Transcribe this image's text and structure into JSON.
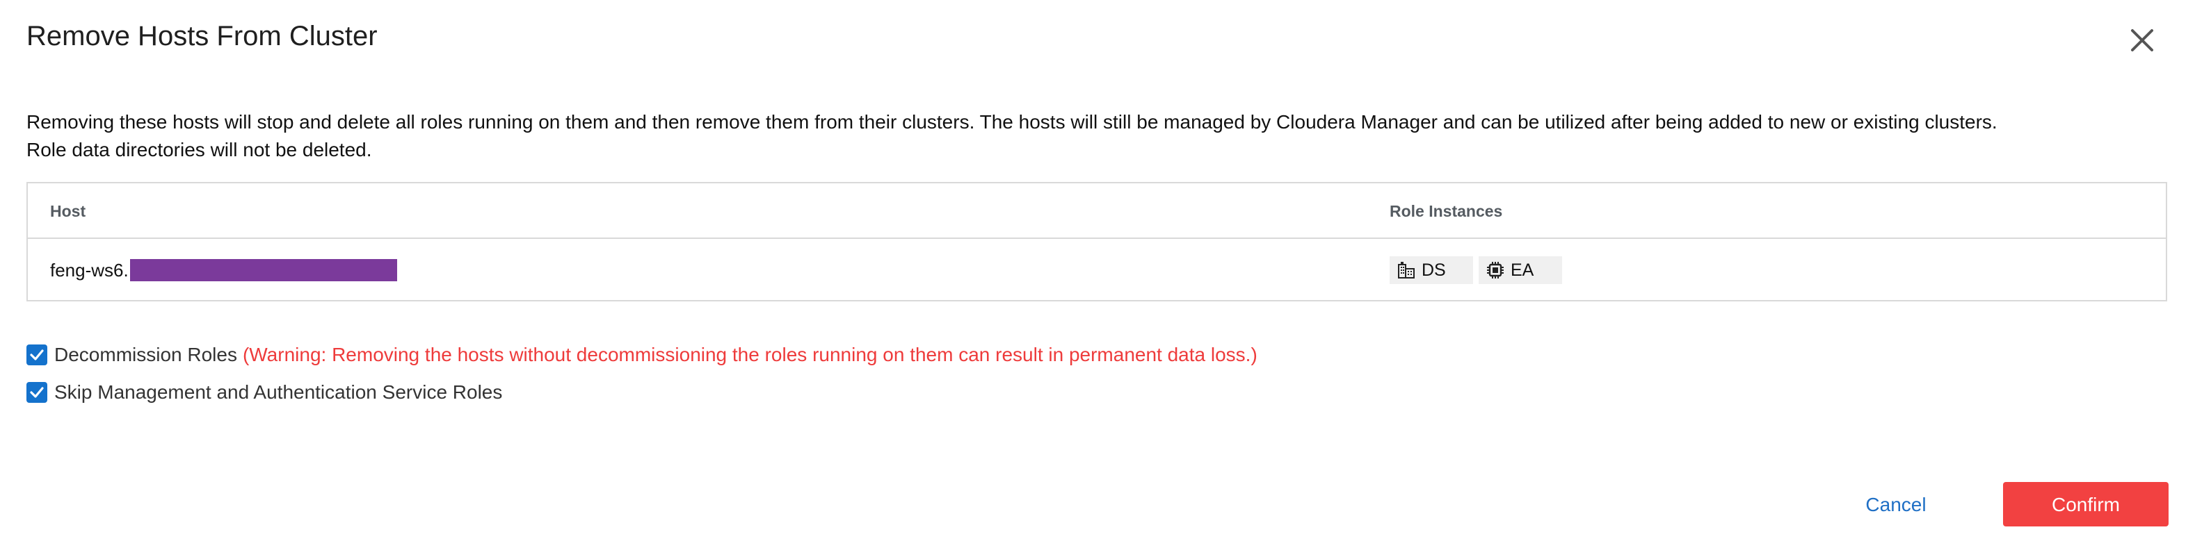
{
  "dialog": {
    "title": "Remove Hosts From Cluster",
    "description_line1": "Removing these hosts will stop and delete all roles running on them and then remove them from their clusters. The hosts will still be managed by Cloudera Manager and can be utilized after being added to new or existing clusters.",
    "description_line2": "Role data directories will not be deleted."
  },
  "table": {
    "columns": [
      "Host",
      "Role Instances"
    ],
    "rows": [
      {
        "host": "feng-ws6.",
        "roles": [
          {
            "label": "DS",
            "icon": "building-icon"
          },
          {
            "label": "EA",
            "icon": "chip-icon"
          }
        ]
      }
    ]
  },
  "options": {
    "decommission_label": "Decommission Roles",
    "decommission_warning": "(Warning: Removing the hosts without decommissioning the roles running on them can result in permanent data loss.)",
    "decommission_checked": true,
    "skip_label": "Skip Management and Authentication Service Roles",
    "skip_checked": true
  },
  "footer": {
    "cancel_label": "Cancel",
    "confirm_label": "Confirm"
  },
  "colors": {
    "accent": "#1472cc",
    "danger": "#f24141",
    "warning_text": "#ee3b3b",
    "link": "#1f6fc5",
    "redaction": "#7b3a9b"
  }
}
